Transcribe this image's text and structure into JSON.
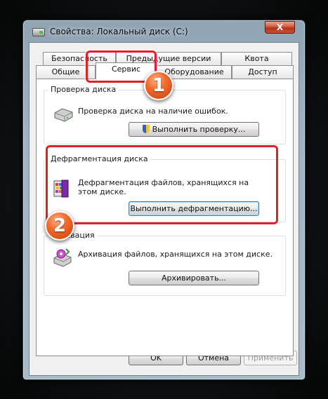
{
  "window": {
    "title": "Свойства: Локальный диск (C:)",
    "close_label": "X"
  },
  "tabs_back": [
    {
      "label": "Безопасность"
    },
    {
      "label": "Предыдущие версии"
    },
    {
      "label": "Квота"
    }
  ],
  "tabs_front": [
    {
      "label": "Общие"
    },
    {
      "label": "Сервис"
    },
    {
      "label": "Оборудование"
    },
    {
      "label": "Доступ"
    }
  ],
  "active_tab": "Сервис",
  "groups": {
    "check": {
      "title": "Проверка диска",
      "description": "Проверка диска на наличие ошибок.",
      "button": "Выполнить проверку..."
    },
    "defrag": {
      "title": "Дефрагментация диска",
      "description": "Дефрагментация файлов, хранящихся на этом диске.",
      "button": "Выполнить дефрагментацию..."
    },
    "backup": {
      "title": "Архивация",
      "description": "Архивация файлов, хранящихся на этом диске.",
      "button": "Архивировать..."
    }
  },
  "footer": {
    "ok": "OK",
    "cancel": "Отмена",
    "apply": "Применить"
  },
  "annotations": {
    "step1": "1",
    "step2": "2"
  },
  "colors": {
    "highlight": "#e0202a",
    "badge": "#f26a2c",
    "close_button": "#c9502f"
  }
}
